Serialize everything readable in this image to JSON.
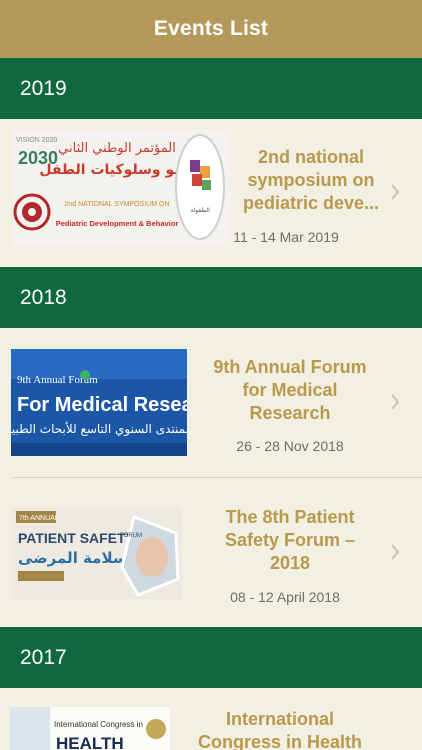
{
  "navbar": {
    "title": "Events List"
  },
  "sections": [
    {
      "label": "2019",
      "events": [
        {
          "title": "2nd  national symposium on pediatric deve...",
          "date": "11 - 14 Mar 2019",
          "thumb": {
            "vision": "VISION 2030",
            "arabic": "المؤتمر الوطني الثاني",
            "arabic2": "لنمو وسلوكيات الطفل",
            "en1": "2nd NATIONAL SYMPOSIUM ON",
            "en2": "Pediatric Development & Behavior"
          }
        }
      ]
    },
    {
      "label": "2018",
      "events": [
        {
          "title": "9th Annual Forum for Medical Research",
          "date": "26 - 28 Nov 2018",
          "thumb": {
            "small": "9th Annual Forum",
            "big": "For Medical Research",
            "arabic": "المنتدى السنوي التاسع للأبحاث الطبية"
          }
        },
        {
          "title": "The 8th Patient Safety Forum – 2018",
          "date": "08 - 12 April 2018",
          "thumb": {
            "annual": "7th ANNUAL",
            "big": "PATIENT SAFETY",
            "forum": "FORUM",
            "arabic": "سلامة المرضى"
          }
        }
      ]
    },
    {
      "label": "2017",
      "events": [
        {
          "title": "International Congress in Health",
          "thumb": {
            "line1": "International Congress in",
            "line2": "HEALTH"
          }
        }
      ]
    }
  ],
  "colors": {
    "gold": "#b39a5a",
    "green": "#10683f",
    "title": "#b99a4c",
    "background": "#f2efe3"
  }
}
